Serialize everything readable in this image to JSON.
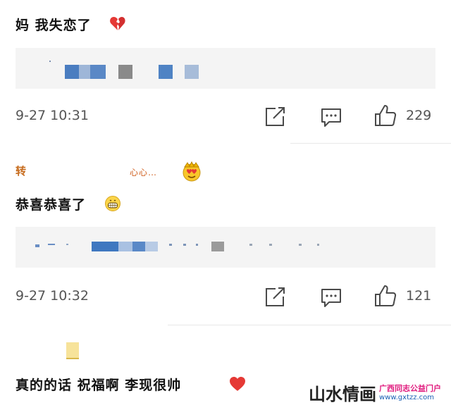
{
  "post1": {
    "text": "妈 我失恋了",
    "emoji": "broken-heart",
    "time": "9-27 10:31",
    "like_count": "229"
  },
  "post2": {
    "username": "转",
    "username_tail": "心心…",
    "badge_emoji": "crown-heart-face",
    "text": "恭喜恭喜了",
    "emoji": "grin-face",
    "time": "9-27 10:32",
    "like_count": "121"
  },
  "post3": {
    "text": "真的的话  祝福啊  李现很帅",
    "emoji": "red-heart"
  },
  "watermark": {
    "brand": "山水情画",
    "subtitle": "广西同志公益门户",
    "url": "www.gxtzz.com"
  },
  "colors": {
    "quote_bg": "#f4f4f4",
    "blur_blue": "#3f78c0",
    "blur_gray": "#8a8a8a",
    "heart_red": "#e53935"
  }
}
